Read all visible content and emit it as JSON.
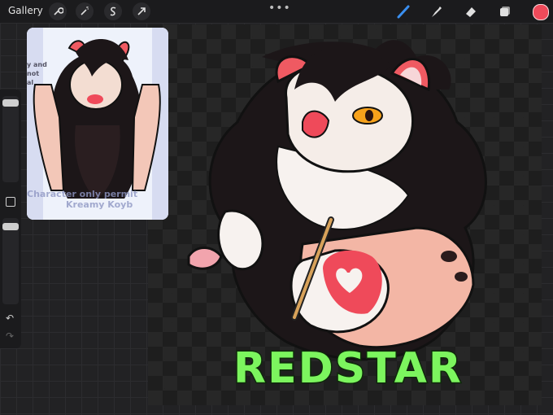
{
  "topbar": {
    "gallery_label": "Gallery",
    "tools": [
      "wrench-icon",
      "magic-wand-icon",
      "selection-s-icon",
      "transform-arrow-icon"
    ],
    "right_tools": [
      "brush-icon",
      "smudge-icon",
      "eraser-icon",
      "layers-icon"
    ],
    "current_color": "#ef4a5a"
  },
  "reference": {
    "lines": [
      "y and",
      "not",
      "al",
      "Character only permit",
      "Kreamy Koyb"
    ]
  },
  "artwork": {
    "title": "REDSTAR",
    "title_color": "#7cf55e"
  },
  "sidebar": {
    "undo_icon": "undo-icon",
    "redo_icon": "redo-icon"
  }
}
